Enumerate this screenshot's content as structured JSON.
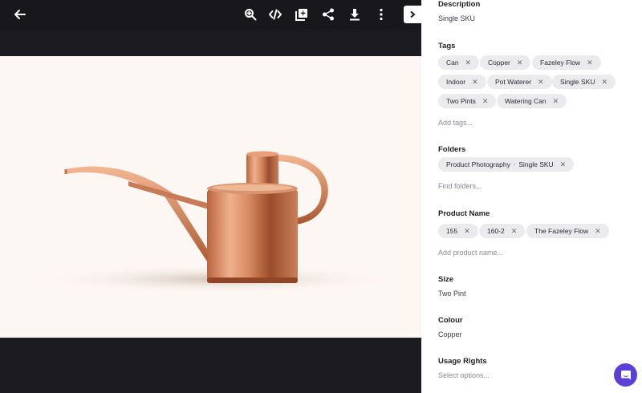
{
  "panel": {
    "description": {
      "title": "Description",
      "value": "Single SKU"
    },
    "tags": {
      "title": "Tags",
      "items": [
        "Can",
        "Copper",
        "Fazeley Flow",
        "Indoor",
        "Pot Waterer",
        "Single SKU",
        "Two Pints",
        "Watering Can"
      ],
      "placeholder": "Add tags..."
    },
    "folders": {
      "title": "Folders",
      "path": [
        "Product Photography",
        "Single SKU"
      ],
      "placeholder": "Find folders..."
    },
    "product_name": {
      "title": "Product Name",
      "items": [
        "155",
        "160-2",
        "The Fazeley Flow"
      ],
      "placeholder": "Add product name..."
    },
    "size": {
      "title": "Size",
      "value": "Two Pint"
    },
    "colour": {
      "title": "Colour",
      "value": "Copper"
    },
    "usage_rights": {
      "title": "Usage Rights",
      "placeholder": "Select options..."
    }
  },
  "icons": {
    "back": "arrow-left-icon",
    "zoom": "zoom-in-icon",
    "embed": "code-icon",
    "add": "add-to-collection-icon",
    "share": "share-icon",
    "download": "download-icon",
    "more": "more-vertical-icon",
    "collapse": "chevron-right-icon",
    "chat": "chat-icon"
  },
  "colors": {
    "viewer_bg": "#1b1b20",
    "stage_bg": "#fdf7f3",
    "chip_bg": "#ebebee",
    "chat_accent": "#5b3fd6",
    "copper": "#c97a55"
  }
}
